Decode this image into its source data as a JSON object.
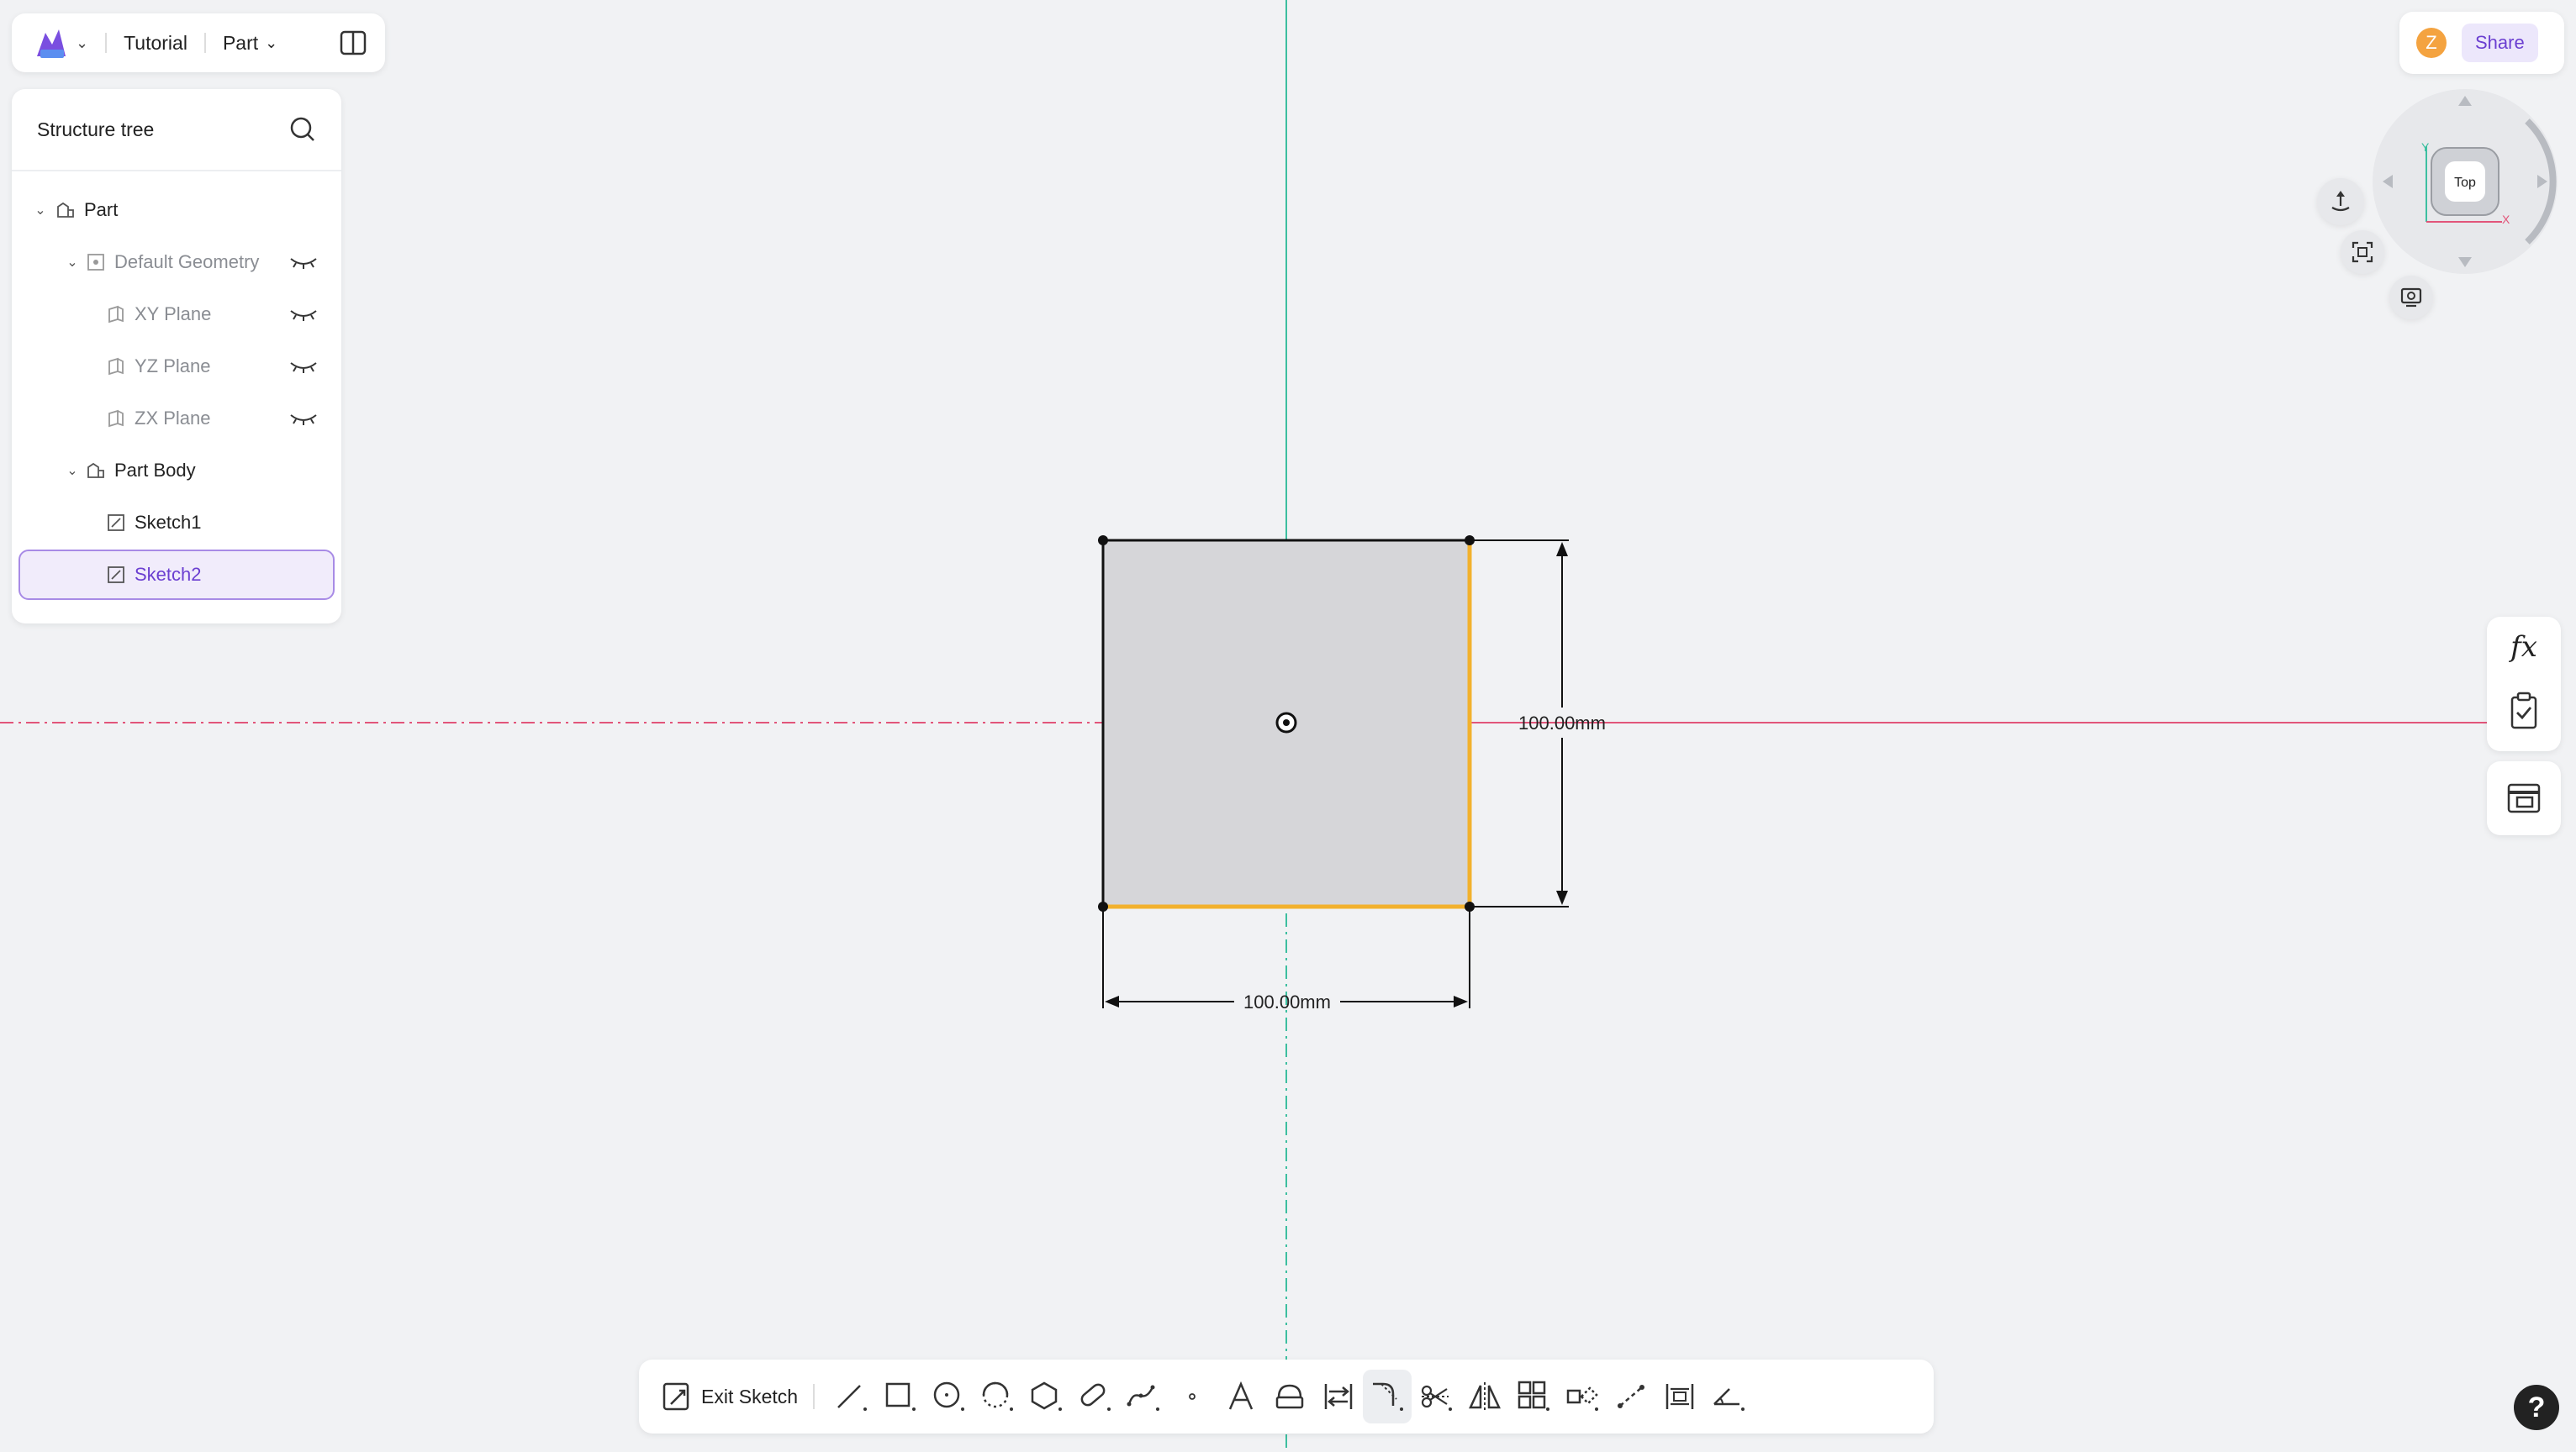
{
  "topbar": {
    "project": "Tutorial",
    "mode": "Part"
  },
  "tree": {
    "title": "Structure tree",
    "items": [
      {
        "label": "Part"
      },
      {
        "label": "Default Geometry"
      },
      {
        "label": "XY Plane"
      },
      {
        "label": "YZ Plane"
      },
      {
        "label": "ZX Plane"
      },
      {
        "label": "Part Body"
      },
      {
        "label": "Sketch1"
      },
      {
        "label": "Sketch2"
      }
    ]
  },
  "account": {
    "avatar_letter": "Z",
    "share_label": "Share"
  },
  "viewcube": {
    "face_label": "Top"
  },
  "sketch": {
    "width_dimension": "100.00mm",
    "height_dimension": "100.00mm"
  },
  "toolbar": {
    "exit_label": "Exit Sketch"
  },
  "help": {
    "label": "?"
  },
  "colors": {
    "accent": "#6b3fd1",
    "highlight_edge": "#f2b12d",
    "x_axis": "#e2557a",
    "y_axis": "#3dbfa0"
  },
  "icons": [
    "logo-icon",
    "split-view-icon",
    "search-icon",
    "eye-closed-icon",
    "function-icon",
    "checklist-icon",
    "table-icon",
    "line-tool-icon",
    "rectangle-tool-icon",
    "circle-tool-icon",
    "arc-tool-icon",
    "polygon-tool-icon",
    "slot-tool-icon",
    "spline-tool-icon",
    "point-tool-icon",
    "text-tool-icon",
    "offset-tool-icon",
    "transform-tool-icon",
    "fillet-tool-icon",
    "trim-tool-icon",
    "mirror-tool-icon",
    "pattern-tool-icon",
    "project-tool-icon",
    "construction-tool-icon",
    "dimension-tool-icon",
    "constraint-tool-icon"
  ]
}
